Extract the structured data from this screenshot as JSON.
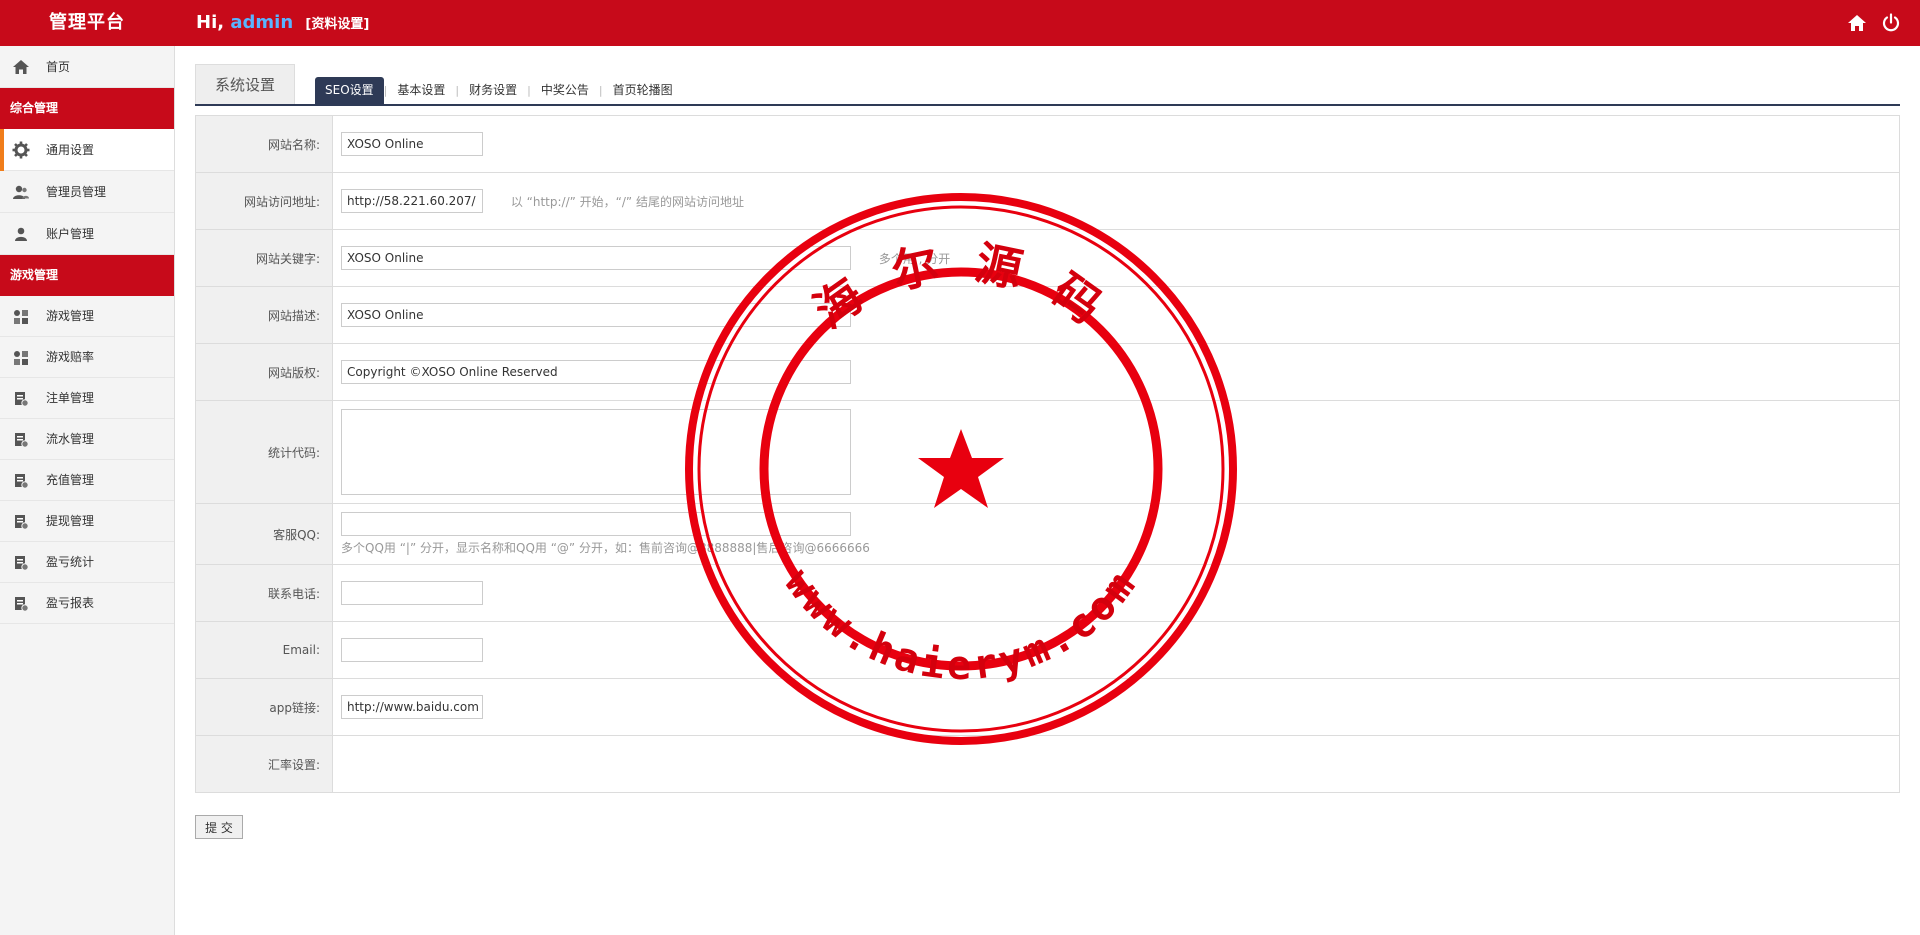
{
  "header": {
    "brand": "管理平台",
    "greeting_prefix": "Hi,",
    "username": "admin",
    "subtitle": "[资料设置]",
    "icons": [
      "home-icon",
      "power-icon"
    ]
  },
  "sidebar": {
    "home": "首页",
    "group1": "综合管理",
    "general_settings": "通用设置",
    "admin_mgmt": "管理员管理",
    "account_mgmt": "账户管理",
    "group2": "游戏管理",
    "game_mgmt": "游戏管理",
    "game_odds": "游戏赔率",
    "bet_mgmt": "注单管理",
    "flow_mgmt": "流水管理",
    "recharge_mgmt": "充值管理",
    "withdraw_mgmt": "提现管理",
    "profit_stats": "盈亏统计",
    "profit_report": "盈亏报表"
  },
  "tabs": {
    "system": "系统设置",
    "seo": "SEO设置",
    "basic": "基本设置",
    "finance": "财务设置",
    "lottery_notice": "中奖公告",
    "carousel": "首页轮播图",
    "separator": "|"
  },
  "form": {
    "site_name_label": "网站名称:",
    "site_name_value": "XOSO Online",
    "site_url_label": "网站访问地址:",
    "site_url_value": "http://58.221.60.207/",
    "site_url_hint": "以 “http://” 开始，“/” 结尾的网站访问地址",
    "keywords_label": "网站关键字:",
    "keywords_value": "XOSO Online",
    "keywords_hint": "多个用 , 分开",
    "description_label": "网站描述:",
    "description_value": "XOSO Online",
    "copyright_label": "网站版权:",
    "copyright_value": "Copyright ©XOSO Online Reserved",
    "stats_code_label": "统计代码:",
    "stats_code_value": "",
    "qq_label": "客服QQ:",
    "qq_value": "",
    "qq_hint": "多个QQ用 “|” 分开，显示名称和QQ用 “@” 分开，如：售前咨询@8888888|售后咨询@6666666",
    "phone_label": "联系电话:",
    "phone_value": "",
    "email_label": "Email:",
    "email_value": "",
    "app_link_label": "app链接:",
    "app_link_value": "http://www.baidu.com",
    "exchange_label": "汇率设置:",
    "submit": "提 交"
  },
  "watermark": {
    "top_text": "海 尔 源 码",
    "bottom_text": "www.haierym.com",
    "color": "#e8000f"
  },
  "colors": {
    "header_red": "#c70a1a",
    "active_accent": "#f07d1a",
    "tab_active": "#2e3a56"
  }
}
